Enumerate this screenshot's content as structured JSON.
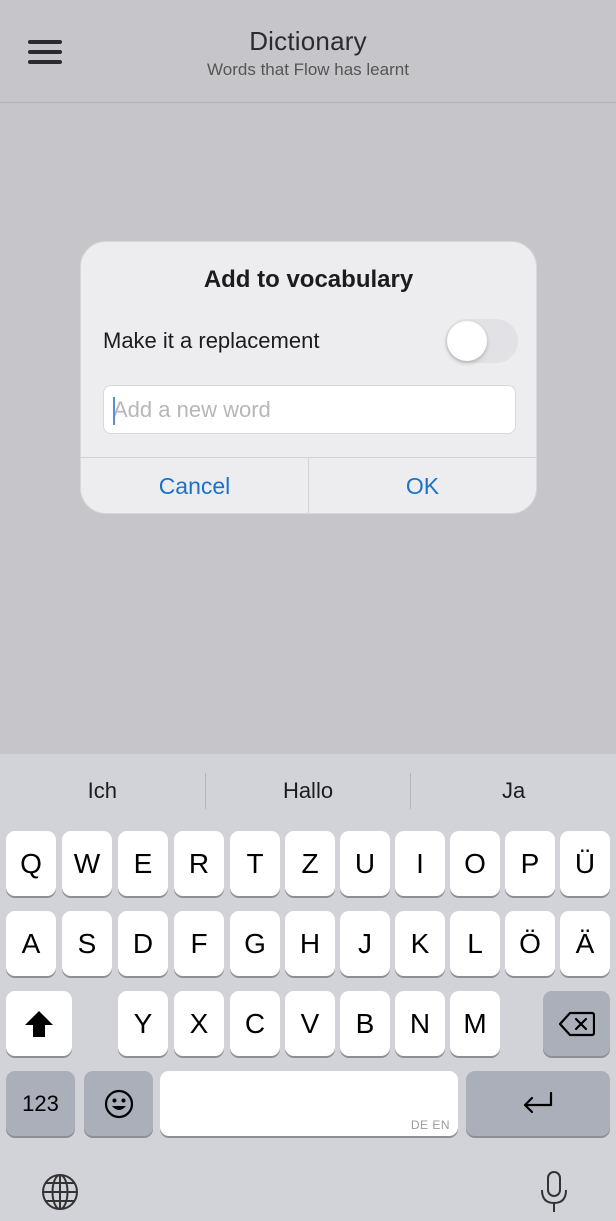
{
  "header": {
    "title": "Dictionary",
    "subtitle": "Words that Flow has learnt",
    "menu_icon": "hamburger-menu-icon"
  },
  "dialog": {
    "title": "Add to vocabulary",
    "replacement_label": "Make it a replacement",
    "replacement_enabled": false,
    "input_value": "",
    "input_placeholder": "Add a new word",
    "cancel_label": "Cancel",
    "ok_label": "OK",
    "accent_color": "#1b72c9"
  },
  "keyboard": {
    "suggestions": [
      "Ich",
      "Hallo",
      "Ja"
    ],
    "row1": [
      "Q",
      "W",
      "E",
      "R",
      "T",
      "Z",
      "U",
      "I",
      "O",
      "P",
      "Ü"
    ],
    "row2": [
      "A",
      "S",
      "D",
      "F",
      "G",
      "H",
      "J",
      "K",
      "L",
      "Ö",
      "Ä"
    ],
    "row3": [
      "Y",
      "X",
      "C",
      "V",
      "B",
      "N",
      "M"
    ],
    "numbers_label": "123",
    "space_hint": "DE EN",
    "icons": [
      "shift-icon",
      "backspace-icon",
      "emoji-icon",
      "return-icon",
      "globe-icon",
      "microphone-icon"
    ]
  }
}
